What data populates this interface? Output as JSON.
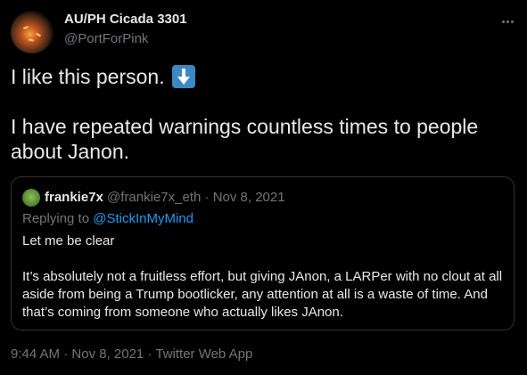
{
  "author": {
    "display_name": "AU/PH Cicada 3301",
    "handle": "@PortForPink",
    "avatar_icon": "fiery-avatar"
  },
  "more_icon": "ellipsis-icon",
  "tweet": {
    "line1": "I like this person.",
    "line1_emoji": "down-arrow-emoji",
    "line2": "I have repeated warnings countless times to people about Janon."
  },
  "quote": {
    "name": "frankie7x",
    "handle": "@frankie7x_eth",
    "separator": "·",
    "date": "Nov 8, 2021",
    "reply_prefix": "Replying to",
    "reply_to": "@StickInMyMind",
    "para1": "Let me be clear",
    "para2": "It’s absolutely not a fruitless effort, but giving JAnon, a LARPer with no clout at all aside from being a Trump bootlicker, any attention at all is a waste of time. And that’s coming from someone who actually likes JAnon."
  },
  "footer": {
    "time": "9:44 AM",
    "separator": "·",
    "date": "Nov 8, 2021",
    "source": "Twitter Web App"
  },
  "colors": {
    "background": "#000000",
    "text": "#e7e9ea",
    "secondary": "#71767b",
    "link": "#1d9bf0",
    "border": "#2f3336"
  }
}
